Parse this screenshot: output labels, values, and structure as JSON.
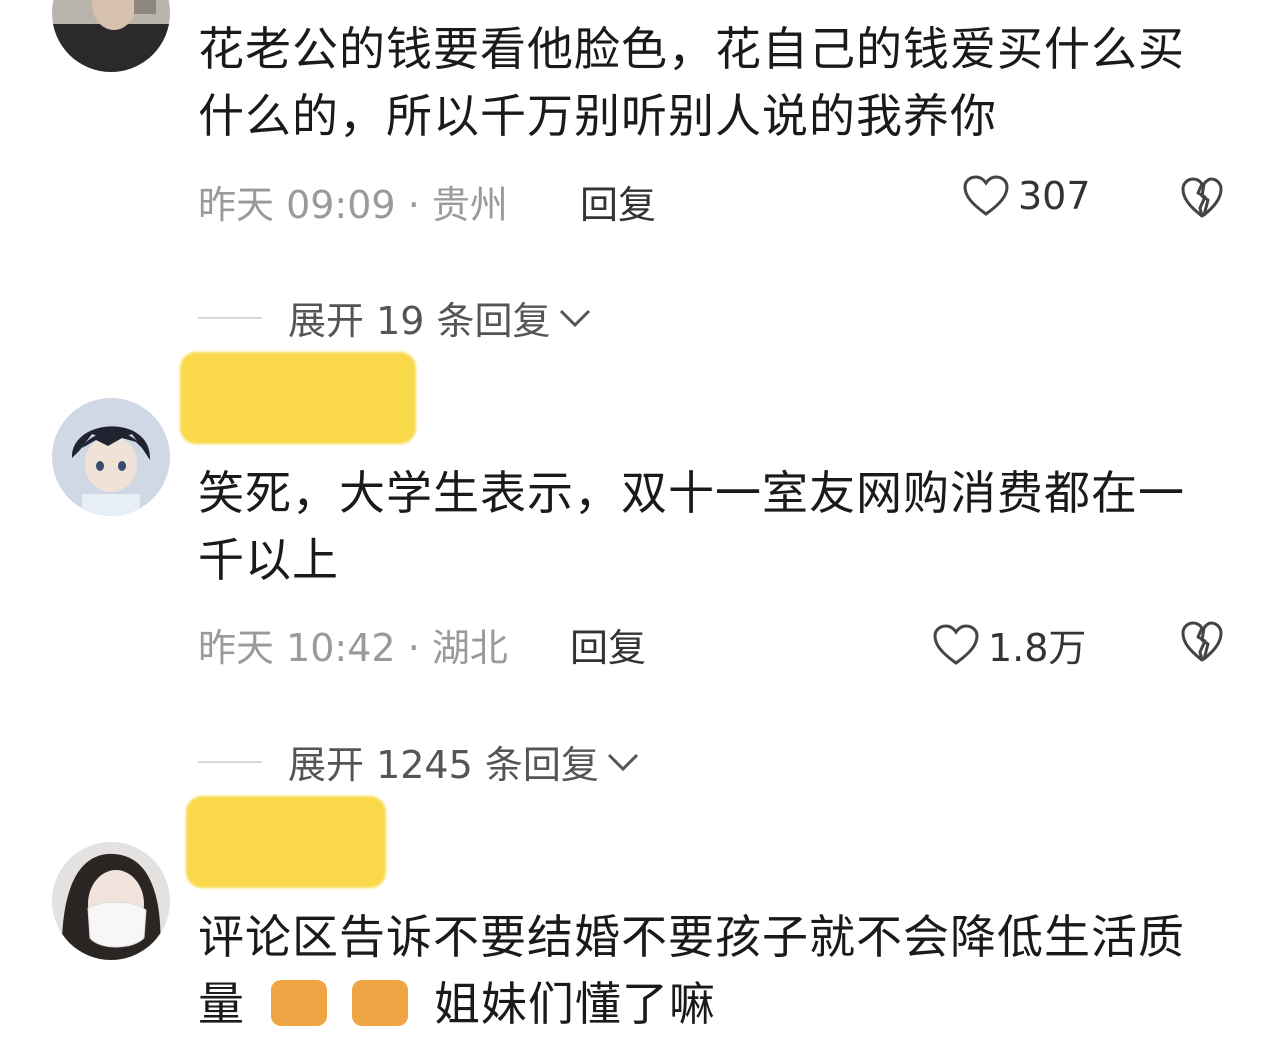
{
  "comments": [
    {
      "text": "花老公的钱要看他脸色，花自己的钱爱买什么买什么的，所以千万别听别人说的我养你",
      "time": "昨天 09:09",
      "location": "· 贵州",
      "reply_label": "回复",
      "likes": "307",
      "expand_label": "展开 19 条回复"
    },
    {
      "text": "笑死，大学生表示，双十一室友网购消费都在一千以上",
      "time": "昨天 10:42",
      "location": "· 湖北",
      "reply_label": "回复",
      "likes": "1.8万",
      "expand_label": "展开 1245 条回复"
    },
    {
      "text": "评论区告诉不要结婚不要孩子就不会降低生活质量",
      "text_tail": "姐妹们懂了嘛"
    }
  ],
  "icons": {
    "like": "heart-outline-icon",
    "dislike": "broken-heart-icon",
    "expand": "chevron-down-icon"
  },
  "colors": {
    "text": "#1a1a1a",
    "meta": "#9a9a9a",
    "redaction": "#f9d94a"
  }
}
